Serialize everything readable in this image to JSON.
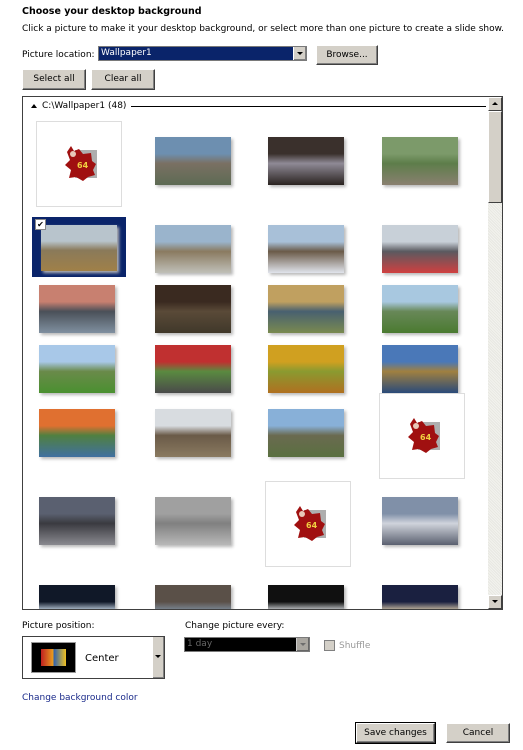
{
  "header": {
    "title": "Choose your desktop background",
    "subtitle": "Click a picture to make it your desktop background, or select more than one picture to create a slide show."
  },
  "location": {
    "label": "Picture location:",
    "value": "Wallpaper1",
    "browse_label": "Browse..."
  },
  "actions": {
    "select_all": "Select all",
    "clear_all": "Clear all"
  },
  "gallery": {
    "group_label": "C:\\Wallpaper1 (48)",
    "selected_index": 4,
    "tiles": [
      {
        "kind": "icon64",
        "text": "64"
      },
      {
        "kind": "photo",
        "colors": [
          "#6d8fb0",
          "#7a7063",
          "#5d6b54"
        ]
      },
      {
        "kind": "photo",
        "colors": [
          "#3a302c",
          "#8f8a96",
          "#2a2320"
        ]
      },
      {
        "kind": "photo",
        "colors": [
          "#7c9a6a",
          "#5d7d4a",
          "#8a8070"
        ]
      },
      {
        "kind": "photo",
        "colors": [
          "#b8c4cc",
          "#8a7a5a",
          "#a08048"
        ]
      },
      {
        "kind": "photo",
        "colors": [
          "#9ab4cc",
          "#8a7a60",
          "#c0c0b8"
        ]
      },
      {
        "kind": "photo",
        "colors": [
          "#a8c0d8",
          "#6a5a48",
          "#e0e4ec"
        ]
      },
      {
        "kind": "photo",
        "colors": [
          "#c8d0d8",
          "#5a5a60",
          "#d04040"
        ]
      },
      {
        "kind": "photo",
        "colors": [
          "#c88070",
          "#4a5058",
          "#8090a0"
        ]
      },
      {
        "kind": "photo",
        "colors": [
          "#3a2a20",
          "#5a4a38",
          "#40382a"
        ]
      },
      {
        "kind": "photo",
        "colors": [
          "#c0a060",
          "#486070",
          "#7a8a50"
        ]
      },
      {
        "kind": "photo",
        "colors": [
          "#a8c8e0",
          "#688858",
          "#4a7a30"
        ]
      },
      {
        "kind": "photo",
        "colors": [
          "#a8c8e8",
          "#6a8a4a",
          "#4a9030"
        ]
      },
      {
        "kind": "photo",
        "colors": [
          "#c03030",
          "#5a8a40",
          "#4a4a4a"
        ]
      },
      {
        "kind": "photo",
        "colors": [
          "#d0a020",
          "#8a9a30",
          "#b07020"
        ]
      },
      {
        "kind": "photo",
        "colors": [
          "#4a78b8",
          "#a08040",
          "#2a4a7a"
        ]
      },
      {
        "kind": "photo",
        "colors": [
          "#e07030",
          "#508040",
          "#4070a0"
        ]
      },
      {
        "kind": "photo",
        "colors": [
          "#d8dce0",
          "#6a5a48",
          "#8a7a60"
        ]
      },
      {
        "kind": "photo",
        "colors": [
          "#88b0d8",
          "#6a6a50",
          "#5a7040"
        ]
      },
      {
        "kind": "icon64",
        "text": "64"
      },
      {
        "kind": "photo",
        "colors": [
          "#5a6070",
          "#3a3a40",
          "#8a8a90"
        ]
      },
      {
        "kind": "photo",
        "colors": [
          "#a0a0a0",
          "#808080",
          "#b8b8b8"
        ]
      },
      {
        "kind": "icon64",
        "text": "64"
      },
      {
        "kind": "photo",
        "colors": [
          "#8090a8",
          "#d0d4dc",
          "#5a6070"
        ]
      },
      {
        "kind": "photo",
        "colors": [
          "#101828",
          "#d0e0f0",
          "#2a3040"
        ]
      },
      {
        "kind": "photo",
        "colors": [
          "#5a5048",
          "#8090a0",
          "#2a2a2a"
        ]
      },
      {
        "kind": "photo",
        "colors": [
          "#101010",
          "#e0e4e8",
          "#203040"
        ]
      },
      {
        "kind": "photo",
        "colors": [
          "#1a2040",
          "#e0d0b0",
          "#c03020"
        ]
      }
    ]
  },
  "position": {
    "label": "Picture position:",
    "value": "Center"
  },
  "slideshow": {
    "label": "Change picture every:",
    "value": "1 day",
    "shuffle_label": "Shuffle",
    "shuffle_checked": false
  },
  "links": {
    "change_bg_color": "Change background color"
  },
  "footer": {
    "save_label": "Save changes",
    "cancel_label": "Cancel"
  }
}
